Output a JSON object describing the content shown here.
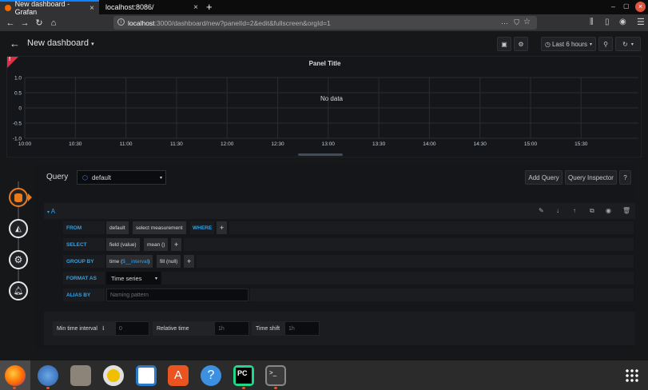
{
  "browser": {
    "tabs": [
      {
        "label": "New dashboard - Grafan",
        "active": true
      },
      {
        "label": "localhost:8086/",
        "active": false
      }
    ],
    "new_tab": "+",
    "url_host": "localhost",
    "url_rest": ":3000/dashboard/new?panelId=2&edit&fullscreen&orgId=1",
    "url_more": "···"
  },
  "header": {
    "title": "New dashboard",
    "time_range": "Last 6 hours"
  },
  "panel": {
    "title": "Panel Title",
    "no_data": "No data",
    "alert_badge": "!"
  },
  "chart_data": {
    "type": "line",
    "title": "Panel Title",
    "y_ticks": [
      "1.0",
      "0.5",
      "0",
      "-0.5",
      "-1.0"
    ],
    "x_ticks": [
      "10:00",
      "10:30",
      "11:00",
      "11:30",
      "12:00",
      "12:30",
      "13:00",
      "13:30",
      "14:00",
      "14:30",
      "15:00",
      "15:30"
    ],
    "ylim": [
      -1.0,
      1.0
    ],
    "series": [],
    "grid": true
  },
  "query": {
    "label": "Query",
    "datasource": "default",
    "add_query": "Add Query",
    "query_inspector": "Query Inspector",
    "help": "?",
    "ref_id": "A",
    "from_label": "FROM",
    "from_policy": "default",
    "from_measurement": "select measurement",
    "where_label": "WHERE",
    "plus": "+",
    "select_label": "SELECT",
    "select_field": "field (value)",
    "select_fn": "mean ()",
    "groupby_label": "GROUP BY",
    "groupby_time_prefix": "time (",
    "groupby_interval": "$__interval",
    "groupby_time_suffix": ")",
    "groupby_fill": "fill (null)",
    "format_label": "FORMAT AS",
    "format_value": "Time series",
    "alias_label": "ALIAS BY",
    "alias_placeholder": "Naming pattern"
  },
  "options": {
    "min_interval_label": "Min time interval",
    "min_interval_placeholder": "0",
    "relative_time_label": "Relative time",
    "relative_time_placeholder": "1h",
    "time_shift_label": "Time shift",
    "time_shift_placeholder": "1h"
  },
  "taskbar": {
    "apps": [
      "firefox",
      "thunderbird",
      "files",
      "rhythmbox",
      "writer",
      "software",
      "help",
      "pycharm",
      "terminal"
    ],
    "pycharm_label": "PC",
    "terminal_label": ">_",
    "help_label": "?"
  }
}
